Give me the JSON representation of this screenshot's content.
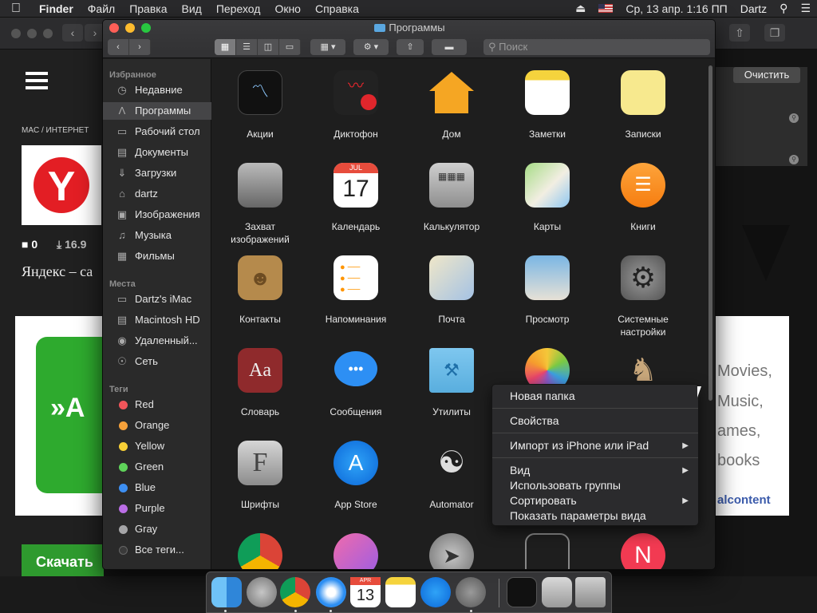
{
  "menubar": {
    "apple": "",
    "items": [
      "Finder",
      "Файл",
      "Правка",
      "Вид",
      "Переход",
      "Окно",
      "Справка"
    ],
    "datetime": "Ср, 13 апр. 1:16 ПП",
    "user": "Dartz"
  },
  "browser": {
    "breadcrumb": "MAC  /  ИНТЕРНЕТ",
    "yandex_letter": "Y",
    "comments": "0",
    "downloads": "16.9",
    "title_fragment": "Яндекс – са",
    "ad_left": "»A",
    "download_button": "Скачать",
    "clear_button": "Очистить",
    "ad_right": [
      "Movies,",
      "Music,",
      "ames,",
      "books"
    ],
    "ad_right_brand": "alcontent"
  },
  "finder": {
    "title": "Программы",
    "search_placeholder": "Поиск",
    "sidebar": {
      "favorites_header": "Избранное",
      "favorites": [
        {
          "label": "Недавние",
          "icon": "clock-icon"
        },
        {
          "label": "Программы",
          "icon": "applications-icon"
        },
        {
          "label": "Рабочий стол",
          "icon": "desktop-icon"
        },
        {
          "label": "Документы",
          "icon": "documents-icon"
        },
        {
          "label": "Загрузки",
          "icon": "downloads-icon"
        },
        {
          "label": "dartz",
          "icon": "home-icon"
        },
        {
          "label": "Изображения",
          "icon": "camera-icon"
        },
        {
          "label": "Музыка",
          "icon": "music-icon"
        },
        {
          "label": "Фильмы",
          "icon": "film-icon"
        }
      ],
      "places_header": "Места",
      "places": [
        {
          "label": "Dartz's iMac",
          "icon": "monitor-icon"
        },
        {
          "label": "Macintosh HD",
          "icon": "disk-icon"
        },
        {
          "label": "Удаленный...",
          "icon": "optical-disc-icon"
        },
        {
          "label": "Сеть",
          "icon": "network-icon"
        }
      ],
      "tags_header": "Теги",
      "tags": [
        {
          "label": "Red",
          "color": "#f2555a"
        },
        {
          "label": "Orange",
          "color": "#f6a13a"
        },
        {
          "label": "Yellow",
          "color": "#f7cf36"
        },
        {
          "label": "Green",
          "color": "#5fd35a"
        },
        {
          "label": "Blue",
          "color": "#3d8ff2"
        },
        {
          "label": "Purple",
          "color": "#bb6ee6"
        },
        {
          "label": "Gray",
          "color": "#a5a5a7"
        },
        {
          "label": "Все теги...",
          "color": "#3a3a3a"
        }
      ]
    },
    "apps": [
      {
        "label": "Акции",
        "icon": "stocks-icon"
      },
      {
        "label": "Диктофон",
        "icon": "voice-memos-icon"
      },
      {
        "label": "Дом",
        "icon": "home-app-icon"
      },
      {
        "label": "Заметки",
        "icon": "notes-icon"
      },
      {
        "label": "Записки",
        "icon": "stickies-icon"
      },
      {
        "label": "Захват изображений",
        "icon": "image-capture-icon"
      },
      {
        "label": "Календарь",
        "icon": "calendar-icon"
      },
      {
        "label": "Калькулятор",
        "icon": "calculator-icon"
      },
      {
        "label": "Карты",
        "icon": "maps-icon"
      },
      {
        "label": "Книги",
        "icon": "books-icon"
      },
      {
        "label": "Контакты",
        "icon": "contacts-icon"
      },
      {
        "label": "Напоминания",
        "icon": "reminders-icon"
      },
      {
        "label": "Почта",
        "icon": "mail-icon"
      },
      {
        "label": "Просмотр",
        "icon": "preview-icon"
      },
      {
        "label": "Системные настройки",
        "icon": "system-preferences-icon"
      },
      {
        "label": "Словарь",
        "icon": "dictionary-icon"
      },
      {
        "label": "Сообщения",
        "icon": "messages-icon"
      },
      {
        "label": "Утилиты",
        "icon": "utilities-folder-icon"
      },
      {
        "label": "",
        "icon": "photos-icon"
      },
      {
        "label": "",
        "icon": "chess-icon"
      },
      {
        "label": "Шрифты",
        "icon": "font-book-icon"
      },
      {
        "label": "App Store",
        "icon": "app-store-icon"
      },
      {
        "label": "Automator",
        "icon": "automator-icon"
      },
      {
        "label": "",
        "icon": "blank-icon"
      },
      {
        "label": "",
        "icon": "blank-icon"
      },
      {
        "label": "",
        "icon": "chrome-icon"
      },
      {
        "label": "",
        "icon": "itunes-icon"
      },
      {
        "label": "",
        "icon": "launchpad-icon"
      },
      {
        "label": "",
        "icon": "mission-control-icon"
      },
      {
        "label": "",
        "icon": "news-icon"
      }
    ],
    "calendar_month": "JUL",
    "calendar_day": "17",
    "dictionary_text": "Aa",
    "fontbook_text": "F"
  },
  "context_menu": {
    "new_folder": "Новая папка",
    "properties": "Свойства",
    "import": "Импорт из iPhone или iPad",
    "view": "Вид",
    "use_groups": "Использовать группы",
    "sort": "Сортировать",
    "show_view_options": "Показать параметры вида"
  },
  "dock": {
    "calendar_day": "13",
    "calendar_month": "APR",
    "items": [
      "finder",
      "launchpad",
      "chrome",
      "safari",
      "calendar",
      "notes",
      "app-store",
      "system-preferences",
      "stocks",
      "preview",
      "trash"
    ]
  }
}
